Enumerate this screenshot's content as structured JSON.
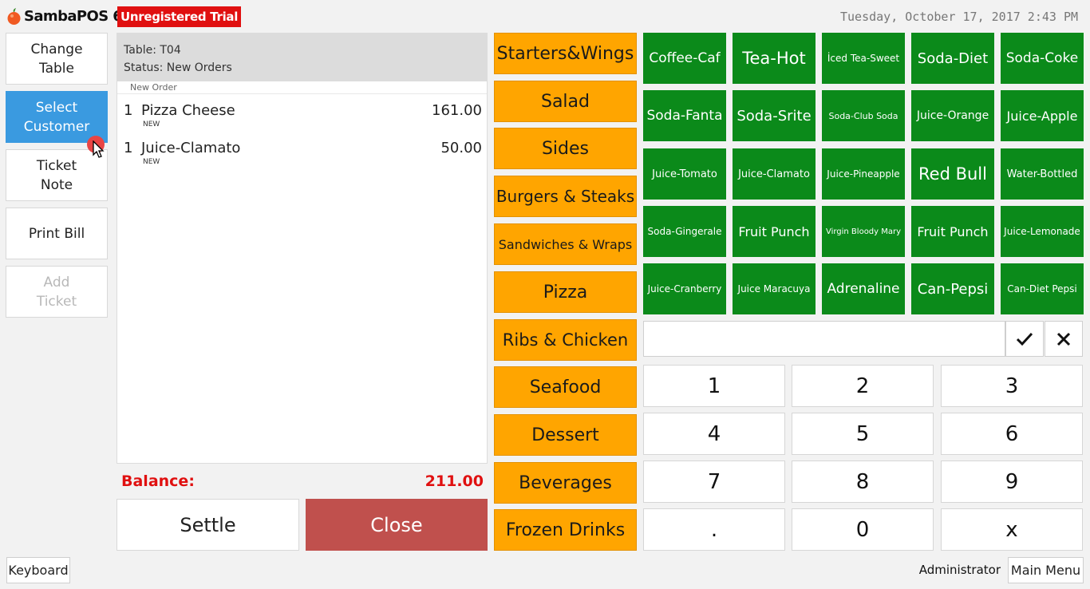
{
  "header": {
    "app_title": "SambaPOS 6",
    "trial_badge": "Unregistered Trial",
    "datetime": "Tuesday, October 17, 2017 2:43 PM"
  },
  "left_buttons": [
    {
      "label": "Change\nTable",
      "state": "normal"
    },
    {
      "label": "Select\nCustomer",
      "state": "active"
    },
    {
      "label": "Ticket\nNote",
      "state": "normal"
    },
    {
      "label": "Print Bill",
      "state": "normal"
    },
    {
      "label": "Add\nTicket",
      "state": "disabled"
    }
  ],
  "ticket": {
    "table": "Table: T04",
    "status": "Status: New Orders",
    "order_header": "New Order",
    "orders": [
      {
        "qty": "1",
        "name": "Pizza Cheese",
        "price": "161.00",
        "tag": "NEW"
      },
      {
        "qty": "1",
        "name": "Juice-Clamato",
        "price": "50.00",
        "tag": "NEW"
      }
    ],
    "balance_label": "Balance:",
    "balance_value": "211.00"
  },
  "actions": {
    "settle": "Settle",
    "close": "Close"
  },
  "categories": [
    "Starters&Wings",
    "Salad",
    "Sides",
    "Burgers & Steaks",
    "Sandwiches & Wraps",
    "Pizza",
    "Ribs & Chicken",
    "Seafood",
    "Dessert",
    "Beverages",
    "Frozen Drinks"
  ],
  "products": [
    "Coffee-Caf",
    "Tea-Hot",
    "İced Tea-Sweet",
    "Soda-Diet",
    "Soda-Coke",
    "Soda-Fanta",
    "Soda-Srite",
    "Soda-Club Soda",
    "Juice-Orange",
    "Juice-Apple",
    "Juice-Tomato",
    "Juice-Clamato",
    "Juice-Pineapple",
    "Red Bull",
    "Water-Bottled",
    "Soda-Gingerale",
    "Fruit Punch",
    "Virgin Bloody Mary",
    "Fruit Punch",
    "Juice-Lemonade",
    "Juice-Cranberry",
    "Juice Maracuya",
    "Adrenaline",
    "Can-Pepsi",
    "Can-Diet Pepsi"
  ],
  "numpad": {
    "input_value": "",
    "keys": [
      "1",
      "2",
      "3",
      "4",
      "5",
      "6",
      "7",
      "8",
      "9",
      ".",
      "0",
      "x"
    ]
  },
  "footer": {
    "keyboard": "Keyboard",
    "user": "Administrator",
    "main_menu": "Main Menu"
  },
  "colors": {
    "category": "#ffa500",
    "product": "#0b8a1a",
    "active_button": "#3a9ae0",
    "close_button": "#c0504d",
    "alert": "#e01010"
  }
}
